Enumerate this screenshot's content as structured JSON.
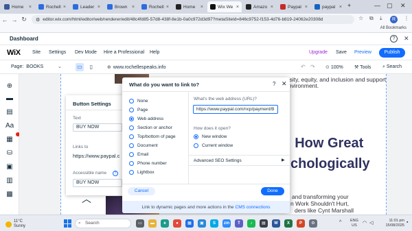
{
  "browser": {
    "tabs": [
      {
        "label": "Home",
        "color": "#3b5998"
      },
      {
        "label": "Rochell",
        "color": "#2d6cdf"
      },
      {
        "label": "Leader",
        "color": "#2d6cdf"
      },
      {
        "label": "Brown",
        "color": "#2d6cdf"
      },
      {
        "label": "Rochell",
        "color": "#2d6cdf"
      },
      {
        "label": "Home",
        "color": "#222222"
      },
      {
        "label": "Wix We",
        "color": "#111111"
      },
      {
        "label": "Amazo",
        "color": "#222222"
      },
      {
        "label": "Paypal",
        "color": "#c62828"
      },
      {
        "label": "paypal",
        "color": "#1565c0"
      }
    ],
    "url": "editor.wix.com/html/editor/web/renderer/edit/48c4fd85-57d8-438f-8e1b-0a0c972d3d97?metaSiteId=846c9752-f153-4d76-b819-24062e20308d",
    "all_bookmarks": "All Bookmarks"
  },
  "dashboard": {
    "title": "Dashboard"
  },
  "wix": {
    "logo": "WiX",
    "menu": [
      "Site",
      "Settings",
      "Dev Mode",
      "Hire a Professional",
      "Help"
    ],
    "upgrade": "Upgrade",
    "save": "Save",
    "preview": "Preview",
    "publish": "Publish"
  },
  "pagebar": {
    "page_label": "Page:",
    "page_name": "BOOKS",
    "site_url": "www.rochellespeaks.info",
    "zoom": "100%",
    "tools": "Tools",
    "search": "Search"
  },
  "canvas": {
    "line1": "have to promote conversations about diversity, equity, and inclusion and support",
    "line2": "environment.",
    "heading1": ": How Great",
    "heading2": "chologically",
    "body1": "and transforming your",
    "body2": "n Work Shouldn't Hurt,",
    "body3": "ders like Cynt Marshall"
  },
  "button_settings": {
    "title": "Button Settings",
    "text_label": "Text",
    "text_value": "BUY NOW",
    "links_label": "Links to",
    "links_value": "https://www.paypal.c",
    "accessible_label": "Accessible name",
    "accessible_value": "BUY NOW"
  },
  "link_dialog": {
    "title": "What do you want to link to?",
    "options": [
      "None",
      "Page",
      "Web address",
      "Section or anchor",
      "Top/bottom of page",
      "Document",
      "Email",
      "Phone number",
      "Lightbox"
    ],
    "selected_index": 2,
    "url_label": "What's the web address (URL)?",
    "url_value": "https://www.paypal.com/ncp/payment/B",
    "open_label": "How does it open?",
    "open_options": [
      "New window",
      "Current window"
    ],
    "open_selected_index": 0,
    "advanced_seo": "Advanced SEO Settings",
    "cancel": "Cancel",
    "done": "Done",
    "footer_text": "Link to dynamic pages and more actions in the",
    "footer_link": "CMS connections"
  },
  "taskbar": {
    "weather_temp": "11°C",
    "weather_desc": "Sunny",
    "search_placeholder": "Search",
    "lang_1": "ENG",
    "lang_2": "US",
    "time": "11:01 pm",
    "date": "15/08/2025"
  },
  "colors": {
    "accent": "#116dff",
    "upgrade": "#9a27d5",
    "heading": "#2e3160"
  }
}
